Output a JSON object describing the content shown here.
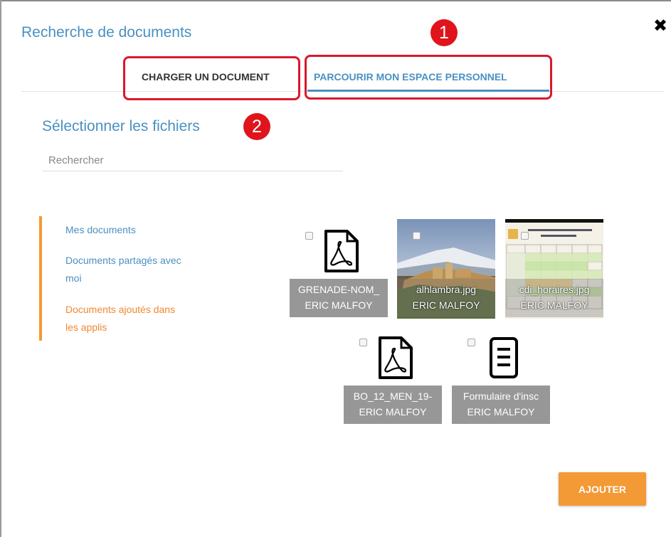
{
  "modal": {
    "title": "Recherche de documents",
    "close_glyph": "✖"
  },
  "tabs": [
    {
      "label": "CHARGER UN DOCUMENT",
      "active": false
    },
    {
      "label": "PARCOURIR MON ESPACE PERSONNEL",
      "active": true
    }
  ],
  "annotations": [
    "1",
    "2"
  ],
  "section_title": "Sélectionner les fichiers",
  "search": {
    "placeholder": "Rechercher",
    "value": ""
  },
  "sidebar": {
    "items": [
      {
        "label": "Mes documents",
        "color": "#4a90c2"
      },
      {
        "label": "Documents partagés avec moi",
        "color": "#4a90c2"
      },
      {
        "label": "Documents ajoutés dans les applis",
        "color": "#f08830",
        "active": true
      }
    ]
  },
  "files": [
    {
      "name": "GRENADE-NOM_",
      "owner": "ERIC MALFOY",
      "icon": "pdf-icon"
    },
    {
      "name": "alhlambra.jpg",
      "owner": "ERIC MALFOY",
      "icon": "image-thumbnail"
    },
    {
      "name": "cdi_horaires.jpg",
      "owner": "ERIC MALFOY",
      "icon": "image-thumbnail"
    },
    {
      "name": "BO_12_MEN_19-",
      "owner": "ERIC MALFOY",
      "icon": "pdf-icon"
    },
    {
      "name": "Formulaire d'insc",
      "owner": "ERIC MALFOY",
      "icon": "document-icon"
    }
  ],
  "actions": {
    "add_label": "AJOUTER"
  },
  "colors": {
    "accent_blue": "#4a90c2",
    "accent_orange": "#f39935",
    "annotation_red": "#e0141c"
  }
}
